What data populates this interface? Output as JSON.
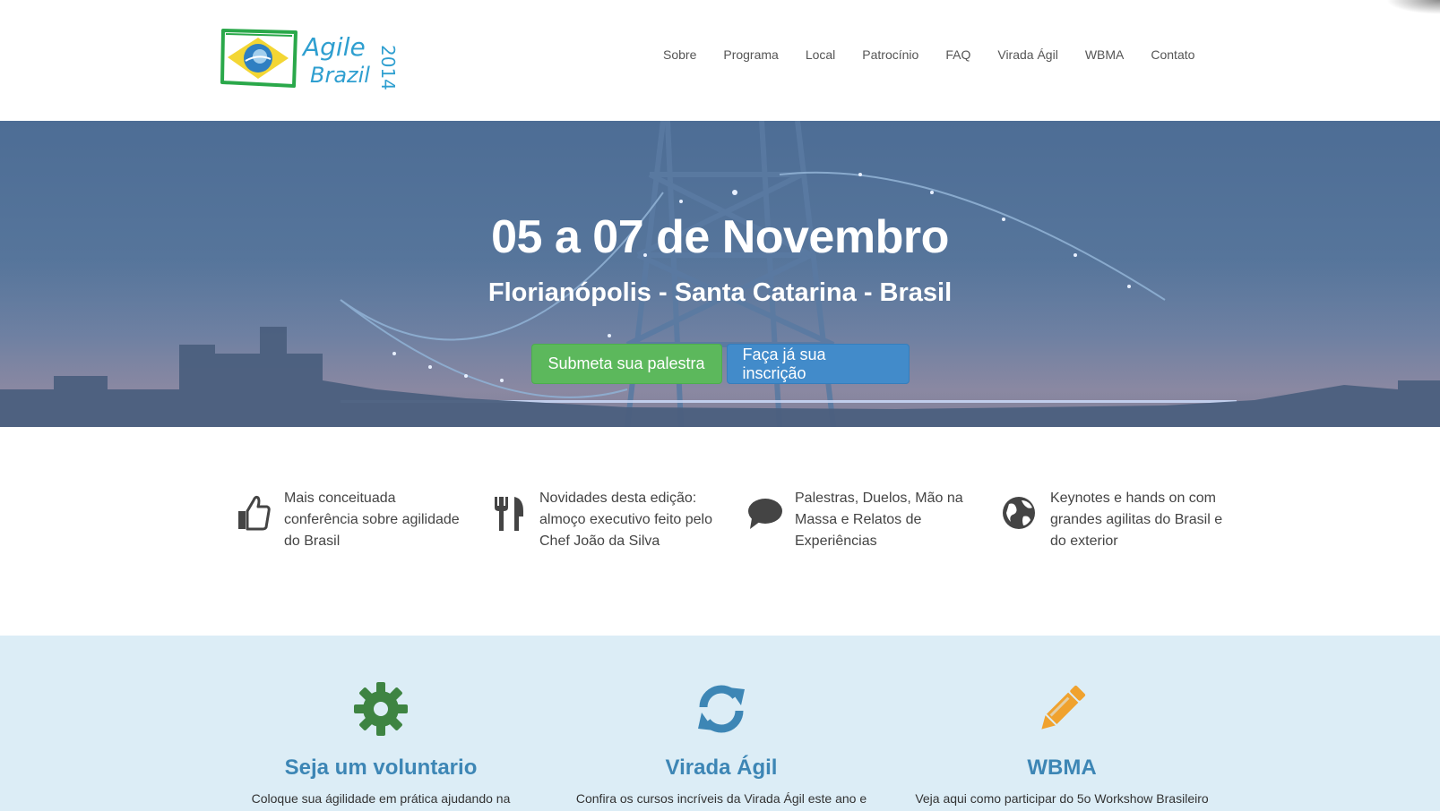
{
  "brand": {
    "logo_line1": "Agile",
    "logo_line2": "Brazil",
    "logo_year": "2014"
  },
  "nav": {
    "items": [
      "Sobre",
      "Programa",
      "Local",
      "Patrocínio",
      "FAQ",
      "Virada Ágil",
      "WBMA",
      "Contato"
    ]
  },
  "hero": {
    "title": "05 a 07 de Novembro",
    "subtitle": "Florianópolis - Santa Catarina - Brasil",
    "primary_button": "Submeta sua palestra",
    "secondary_button": "Faça já sua inscrição"
  },
  "features": [
    {
      "icon": "thumbs-up-icon",
      "text": "Mais conceituada conferência sobre agilidade do Brasil"
    },
    {
      "icon": "cutlery-icon",
      "text": "Novidades desta edição: almoço executivo feito pelo Chef João da Silva"
    },
    {
      "icon": "speech-bubble-icon",
      "text": "Palestras, Duelos, Mão na Massa e Relatos de Experiências"
    },
    {
      "icon": "globe-icon",
      "text": "Keynotes e hands on com grandes agilitas do Brasil e do exterior"
    }
  ],
  "info": [
    {
      "icon": "gear-icon",
      "title": "Seja um voluntario",
      "text": "Coloque sua ágilidade em prática ajudando na",
      "color": "#3e8442"
    },
    {
      "icon": "refresh-icon",
      "title": "Virada Ágil",
      "text": "Confira os cursos incríveis da Virada Ágil este ano e",
      "color": "#3d86b5"
    },
    {
      "icon": "pencil-icon",
      "title": "WBMA",
      "text": "Veja aqui como participar do 5o Workshow Brasileiro",
      "color": "#f0a22e"
    }
  ],
  "colors": {
    "accent": "#3d86b5",
    "button_green": "#5cb85c",
    "button_blue": "#428bca",
    "band_background": "#dcedf6"
  }
}
